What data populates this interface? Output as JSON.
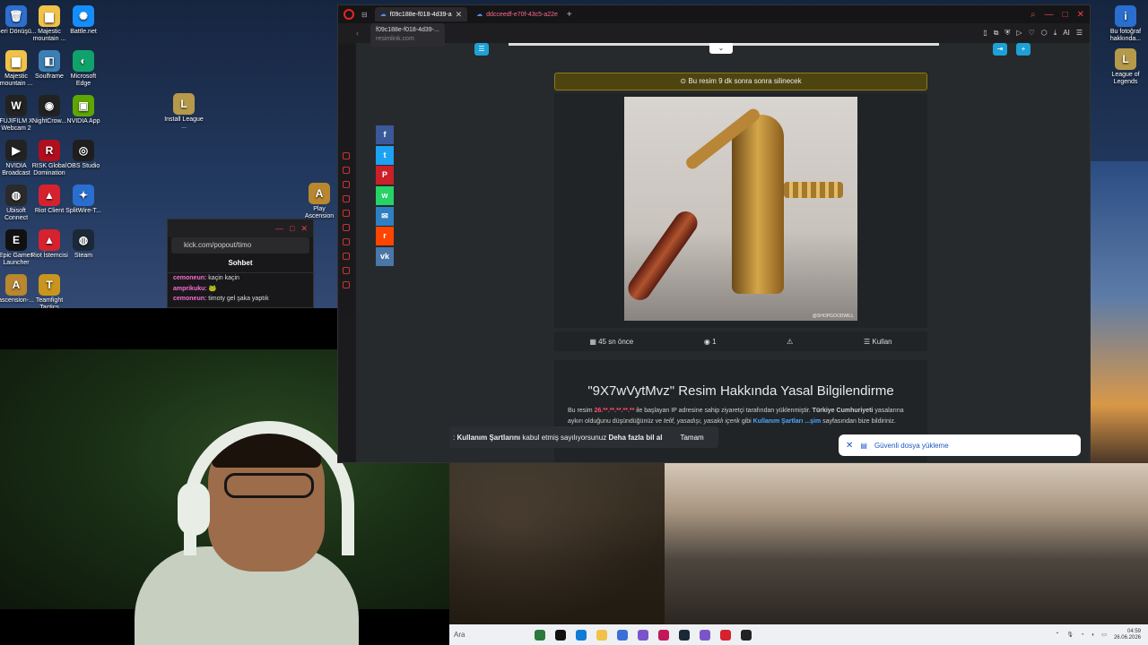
{
  "desktop_left": [
    {
      "label": "Geri Dönüşü...",
      "color": "#2d6fcf",
      "glyph": "🗑"
    },
    {
      "label": "Majestic mountain ...",
      "color": "#f0c24a",
      "glyph": "▆"
    },
    {
      "label": "Battle.net",
      "color": "#148eff",
      "glyph": "✺"
    },
    {
      "label": "Majestic mountain ...",
      "color": "#f0c24a",
      "glyph": "▆"
    },
    {
      "label": "Soulframe",
      "color": "#3d7fb3",
      "glyph": "◧"
    },
    {
      "label": "Microsoft Edge",
      "color": "#0fa36b",
      "glyph": "◐"
    },
    {
      "label": "FUJIFILM X Webcam 2",
      "color": "#222222",
      "glyph": "W"
    },
    {
      "label": "NightCrow...",
      "color": "#222222",
      "glyph": "◉"
    },
    {
      "label": "NVIDIA App",
      "color": "#5ea600",
      "glyph": "▣"
    },
    {
      "label": "NVIDIA Broadcast",
      "color": "#222222",
      "glyph": "▶"
    },
    {
      "label": "RISK Global Domination",
      "color": "#b10e1e",
      "glyph": "R"
    },
    {
      "label": "OBS Studio",
      "color": "#1e1e1e",
      "glyph": "◎"
    },
    {
      "label": "Ubisoft Connect",
      "color": "#2a2a2a",
      "glyph": "◍"
    },
    {
      "label": "Riot Client",
      "color": "#d6222e",
      "glyph": "▲"
    },
    {
      "label": "SplitWire-T...",
      "color": "#2a6fcf",
      "glyph": "✦"
    },
    {
      "label": "Epic Games Launcher",
      "color": "#111111",
      "glyph": "E"
    },
    {
      "label": "Riot İstemcisi",
      "color": "#d6222e",
      "glyph": "▲"
    },
    {
      "label": "Steam",
      "color": "#1b2838",
      "glyph": "◍"
    },
    {
      "label": "ascension-...",
      "color": "#b8872f",
      "glyph": "A"
    },
    {
      "label": "Teamfight Tactics",
      "color": "#c8951e",
      "glyph": "T"
    }
  ],
  "desktop_extra": [
    {
      "label": "Install League ...",
      "color": "#b69a4a",
      "glyph": "L"
    },
    {
      "label": "Play Ascension",
      "color": "#b8872f",
      "glyph": "A"
    }
  ],
  "desktop_right": [
    {
      "label": "Bu fotoğraf hakkında...",
      "color": "#2a6fcf",
      "glyph": "i"
    },
    {
      "label": "League of Legends",
      "color": "#b69a4a",
      "glyph": "L"
    }
  ],
  "chat": {
    "url": "kick.com/popout/timo",
    "title": "Sohbet",
    "messages": [
      {
        "user": "cemoneun:",
        "text": "kaçin kaçin"
      },
      {
        "user": "amprikuku:",
        "text": "🐸"
      },
      {
        "user": "cemoneun:",
        "text": "timoty gel şaka yaptık"
      }
    ]
  },
  "browser": {
    "tabs": [
      {
        "label": "f09c188e-f018-4d39-a",
        "active": true
      },
      {
        "label": "ddcceedf-e70f-43c5-a22e",
        "active": false
      }
    ],
    "tooltip_title": "f09c188e-f018-4d39-...",
    "tooltip_site": "resimlink.com",
    "ai_label": "AI",
    "warning": "Bu resim 9 dk sonra sonra silinecek",
    "watermark": "@SHOPGOODWILL",
    "meta": {
      "time": "45 sn önce",
      "views": "1",
      "use": "Kullan"
    },
    "legal_title": "\"9X7wVytMvz\" Resim Hakkında Yasal Bilgilendirme",
    "legal_p1_a": "Bu resim",
    "legal_ip": "26.**.**.**.**.**",
    "legal_p1_b": "ile başlayan IP adresine sahip ziyaretçi tarafından yüklenmiştir.",
    "legal_tr": "Türkiye Cumhuriyeti",
    "legal_p1_c": "yasalarına aykırı olduğunu düşündüğünüz ve",
    "legal_italic": "telif, yasadışı, yasaklı içerik",
    "legal_p1_d": "gibi",
    "legal_link1": "Kullanım Şartları",
    "legal_link2": "...şim",
    "legal_p1_e": "sayfasından bize bildiriniz."
  },
  "share_buttons": [
    {
      "name": "facebook",
      "color": "#3b5998",
      "glyph": "f"
    },
    {
      "name": "twitter",
      "color": "#1da1f2",
      "glyph": "t"
    },
    {
      "name": "pinterest",
      "color": "#cb2027",
      "glyph": "P"
    },
    {
      "name": "whatsapp",
      "color": "#25d366",
      "glyph": "w"
    },
    {
      "name": "email",
      "color": "#2f7fc2",
      "glyph": "✉"
    },
    {
      "name": "reddit",
      "color": "#ff4500",
      "glyph": "r"
    },
    {
      "name": "vk",
      "color": "#4a76a8",
      "glyph": "vk"
    }
  ],
  "cookie": {
    "lead": "Kullanım Şartlarını",
    "text": "kabul etmiş sayılıyorsunuz",
    "more": "Deha fazla bil al",
    "ok": "Tamam"
  },
  "toast": {
    "text": "Güvenli dosya yükleme"
  },
  "taskbar": {
    "search_placeholder": "Ara",
    "time": "04:59",
    "date": "26.06.2026",
    "app_colors": [
      "#2a7a3c",
      "#111",
      "#0f7bd6",
      "#f0c24a",
      "#3a6fd6",
      "#7a55c9",
      "#c2185b",
      "#1b2838",
      "#7a55c9",
      "#d6222e",
      "#222"
    ]
  }
}
